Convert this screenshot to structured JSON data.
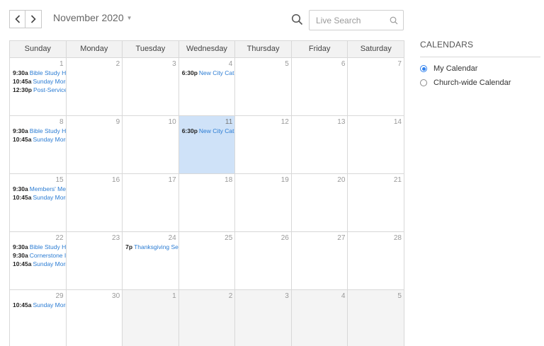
{
  "header": {
    "prev_icon": "chevron-left-icon",
    "next_icon": "chevron-right-icon",
    "month_label": "November 2020",
    "search_placeholder": "Live Search"
  },
  "calendar": {
    "weekdays": [
      "Sunday",
      "Monday",
      "Tuesday",
      "Wednesday",
      "Thursday",
      "Friday",
      "Saturday"
    ],
    "weeks": [
      [
        {
          "day": "1",
          "other": false,
          "today": false,
          "events": [
            {
              "time": "9:30a",
              "title": "Bible Study H"
            },
            {
              "time": "10:45a",
              "title": "Sunday Morr"
            },
            {
              "time": "12:30p",
              "title": "Post-Service"
            }
          ]
        },
        {
          "day": "2",
          "other": false,
          "today": false,
          "events": []
        },
        {
          "day": "3",
          "other": false,
          "today": false,
          "events": []
        },
        {
          "day": "4",
          "other": false,
          "today": false,
          "events": [
            {
              "time": "6:30p",
              "title": "New City Cat"
            }
          ]
        },
        {
          "day": "5",
          "other": false,
          "today": false,
          "events": []
        },
        {
          "day": "6",
          "other": false,
          "today": false,
          "events": []
        },
        {
          "day": "7",
          "other": false,
          "today": false,
          "events": []
        }
      ],
      [
        {
          "day": "8",
          "other": false,
          "today": false,
          "events": [
            {
              "time": "9:30a",
              "title": "Bible Study H"
            },
            {
              "time": "10:45a",
              "title": "Sunday Morr"
            }
          ]
        },
        {
          "day": "9",
          "other": false,
          "today": false,
          "events": []
        },
        {
          "day": "10",
          "other": false,
          "today": false,
          "events": []
        },
        {
          "day": "11",
          "other": false,
          "today": true,
          "events": [
            {
              "time": "6:30p",
              "title": "New City Cat"
            }
          ]
        },
        {
          "day": "12",
          "other": false,
          "today": false,
          "events": []
        },
        {
          "day": "13",
          "other": false,
          "today": false,
          "events": []
        },
        {
          "day": "14",
          "other": false,
          "today": false,
          "events": []
        }
      ],
      [
        {
          "day": "15",
          "other": false,
          "today": false,
          "events": [
            {
              "time": "9:30a",
              "title": "Members' Me"
            },
            {
              "time": "10:45a",
              "title": "Sunday Morr"
            }
          ]
        },
        {
          "day": "16",
          "other": false,
          "today": false,
          "events": []
        },
        {
          "day": "17",
          "other": false,
          "today": false,
          "events": []
        },
        {
          "day": "18",
          "other": false,
          "today": false,
          "events": []
        },
        {
          "day": "19",
          "other": false,
          "today": false,
          "events": []
        },
        {
          "day": "20",
          "other": false,
          "today": false,
          "events": []
        },
        {
          "day": "21",
          "other": false,
          "today": false,
          "events": []
        }
      ],
      [
        {
          "day": "22",
          "other": false,
          "today": false,
          "events": [
            {
              "time": "9:30a",
              "title": "Bible Study H"
            },
            {
              "time": "9:30a",
              "title": "Cornerstone I"
            },
            {
              "time": "10:45a",
              "title": "Sunday Morr"
            }
          ]
        },
        {
          "day": "23",
          "other": false,
          "today": false,
          "events": []
        },
        {
          "day": "24",
          "other": false,
          "today": false,
          "events": [
            {
              "time": "7p",
              "title": "Thanksgiving Ser"
            }
          ]
        },
        {
          "day": "25",
          "other": false,
          "today": false,
          "events": []
        },
        {
          "day": "26",
          "other": false,
          "today": false,
          "events": []
        },
        {
          "day": "27",
          "other": false,
          "today": false,
          "events": []
        },
        {
          "day": "28",
          "other": false,
          "today": false,
          "events": []
        }
      ],
      [
        {
          "day": "29",
          "other": false,
          "today": false,
          "events": [
            {
              "time": "10:45a",
              "title": "Sunday Morr"
            }
          ]
        },
        {
          "day": "30",
          "other": false,
          "today": false,
          "events": []
        },
        {
          "day": "1",
          "other": true,
          "today": false,
          "events": []
        },
        {
          "day": "2",
          "other": true,
          "today": false,
          "events": []
        },
        {
          "day": "3",
          "other": true,
          "today": false,
          "events": []
        },
        {
          "day": "4",
          "other": true,
          "today": false,
          "events": []
        },
        {
          "day": "5",
          "other": true,
          "today": false,
          "events": []
        }
      ]
    ]
  },
  "sidebar": {
    "title": "CALENDARS",
    "options": [
      {
        "label": "My Calendar",
        "checked": true
      },
      {
        "label": "Church-wide Calendar",
        "checked": false
      }
    ]
  },
  "colors": {
    "accent": "#2f80ed",
    "event_link": "#2b7cd3",
    "today_bg": "#cfe2f8",
    "other_month_bg": "#f4f4f4"
  }
}
